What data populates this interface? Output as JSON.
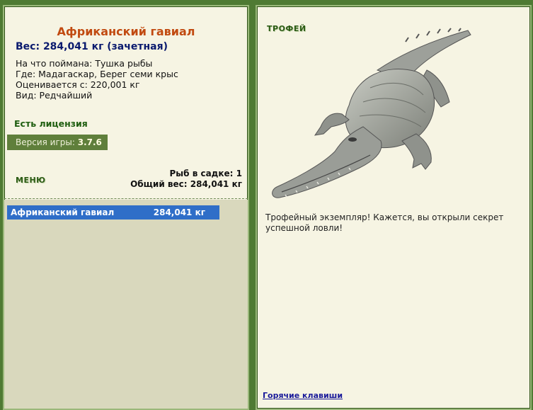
{
  "fish": {
    "name": "Африканский гавиал",
    "weight": "Вес: 284,041 кг (зачетная)",
    "bait": "На что поймана: Тушка рыбы",
    "location": "Где: Мадагаскар, Берег семи крыс",
    "value": "Оценивается с: 220,001 кг",
    "species_rarity": "Вид: Редчайший"
  },
  "license": "Есть лицензия",
  "version": {
    "label": "Версия игры:",
    "value": "3.7.6"
  },
  "menu_label": "МЕНЮ",
  "stats": {
    "count": "Рыб в садке: 1",
    "total_weight": "Общий вес: 284,041 кг"
  },
  "keepnet": [
    {
      "name": "Африканский гавиал",
      "weight": "284,041 кг"
    }
  ],
  "trophy": {
    "label": "ТРОФЕЙ",
    "description": "Трофейный экземпляр! Кажется, вы открыли секрет успешной ловли!"
  },
  "hotkeys_link": "Горячие клавиши",
  "colors": {
    "frame": "#4f7a33",
    "panel": "#f6f4e3",
    "selection": "#2f6ec8",
    "fish_name": "#c14a10"
  },
  "icons": {
    "trophy_image": "crocodile-gavial-image"
  }
}
